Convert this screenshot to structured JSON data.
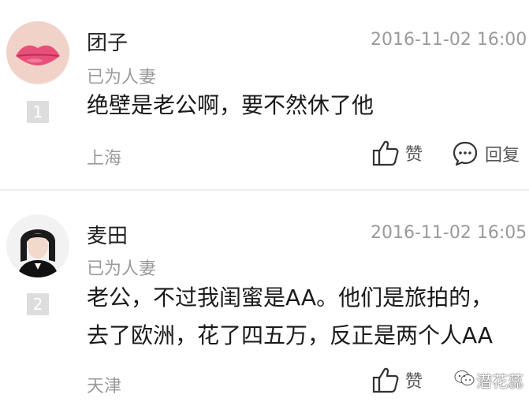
{
  "comments": [
    {
      "username": "团子",
      "timestamp": "2016-11-02 16:00",
      "badge": "已为人妻",
      "floor": "1",
      "content_lines": [
        "绝壁是老公啊，要不然休了他"
      ],
      "location": "上海",
      "like_label": "赞",
      "reply_label": "回复",
      "avatar_icon": "lips-avatar-icon"
    },
    {
      "username": "麦田",
      "timestamp": "2016-11-02 16:05",
      "badge": "已为人妻",
      "floor": "2",
      "content_lines": [
        "老公，不过我闺蜜是AA。他们是旅拍的，",
        "去了欧洲，花了四五万，反正是两个人AA"
      ],
      "location": "天津",
      "like_label": "赞",
      "avatar_icon": "girl-avatar-icon"
    }
  ],
  "watermark": {
    "text": "潜花蕊",
    "icon": "wechat-icon"
  },
  "colors": {
    "text_primary": "#1a1a1a",
    "text_secondary": "#9a9a9a",
    "floor_badge": "#dddddd",
    "divider": "#eeeeee"
  }
}
